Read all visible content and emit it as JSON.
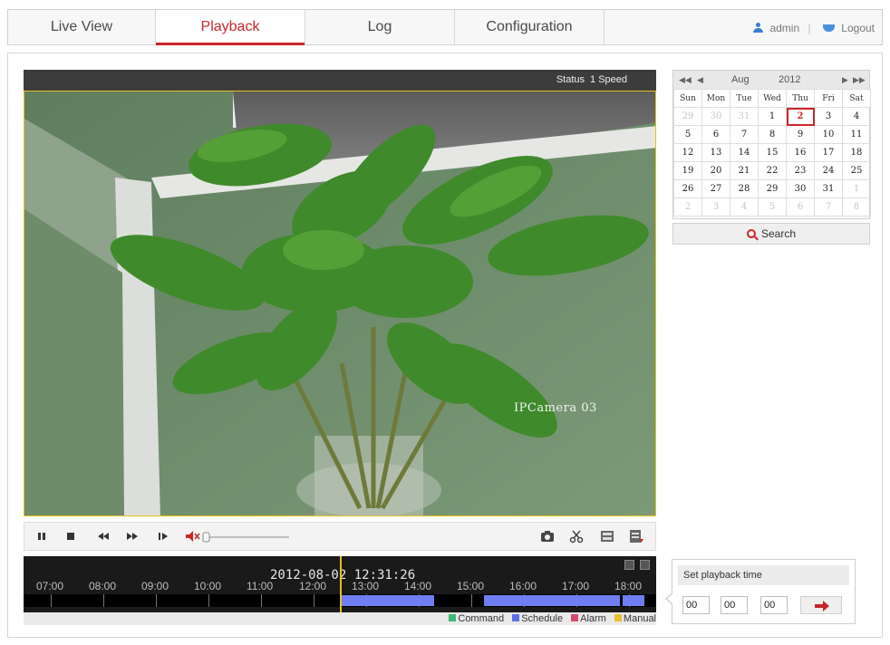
{
  "nav": {
    "tabs": [
      {
        "label": "Live View",
        "active": false
      },
      {
        "label": "Playback",
        "active": true
      },
      {
        "label": "Log",
        "active": false
      },
      {
        "label": "Configuration",
        "active": false
      }
    ],
    "user": "admin",
    "logout": "Logout"
  },
  "player": {
    "status_label": "Status",
    "status_value": "1 Speed",
    "osd_text": "IPCamera 03"
  },
  "controls": {
    "volume_level": 0.0
  },
  "timeline": {
    "datetime": "2012-08-02 12:31:26",
    "hours": [
      "07:00",
      "08:00",
      "09:00",
      "10:00",
      "11:00",
      "12:00",
      "13:00",
      "14:00",
      "15:00",
      "16:00",
      "17:00",
      "18:00"
    ],
    "legend": [
      {
        "label": "Command",
        "color": "#3db87a"
      },
      {
        "label": "Schedule",
        "color": "#5e6ee8"
      },
      {
        "label": "Alarm",
        "color": "#d9486a"
      },
      {
        "label": "Manual",
        "color": "#e8c030"
      }
    ]
  },
  "calendar": {
    "month": "Aug",
    "year": "2012",
    "weekdays": [
      "Sun",
      "Mon",
      "Tue",
      "Wed",
      "Thu",
      "Fri",
      "Sat"
    ],
    "selected_day": "2",
    "weeks": [
      [
        {
          "d": "29",
          "o": true
        },
        {
          "d": "30",
          "o": true
        },
        {
          "d": "31",
          "o": true
        },
        {
          "d": "1"
        },
        {
          "d": "2",
          "s": true
        },
        {
          "d": "3"
        },
        {
          "d": "4"
        }
      ],
      [
        {
          "d": "5"
        },
        {
          "d": "6"
        },
        {
          "d": "7"
        },
        {
          "d": "8"
        },
        {
          "d": "9"
        },
        {
          "d": "10"
        },
        {
          "d": "11"
        }
      ],
      [
        {
          "d": "12"
        },
        {
          "d": "13"
        },
        {
          "d": "14"
        },
        {
          "d": "15"
        },
        {
          "d": "16"
        },
        {
          "d": "17"
        },
        {
          "d": "18"
        }
      ],
      [
        {
          "d": "19"
        },
        {
          "d": "20"
        },
        {
          "d": "21"
        },
        {
          "d": "22"
        },
        {
          "d": "23"
        },
        {
          "d": "24"
        },
        {
          "d": "25"
        }
      ],
      [
        {
          "d": "26"
        },
        {
          "d": "27"
        },
        {
          "d": "28"
        },
        {
          "d": "29"
        },
        {
          "d": "30"
        },
        {
          "d": "31"
        },
        {
          "d": "1",
          "o": true
        }
      ],
      [
        {
          "d": "2",
          "o": true
        },
        {
          "d": "3",
          "o": true
        },
        {
          "d": "4",
          "o": true
        },
        {
          "d": "5",
          "o": true
        },
        {
          "d": "6",
          "o": true
        },
        {
          "d": "7",
          "o": true
        },
        {
          "d": "8",
          "o": true
        }
      ]
    ],
    "search_label": "Search"
  },
  "playback_time": {
    "title": "Set playback time",
    "hour": "00",
    "minute": "00",
    "second": "00"
  },
  "colors": {
    "accent": "#c8262a",
    "record_segment": "#6f7ef0",
    "cursor": "#e5c21f"
  }
}
